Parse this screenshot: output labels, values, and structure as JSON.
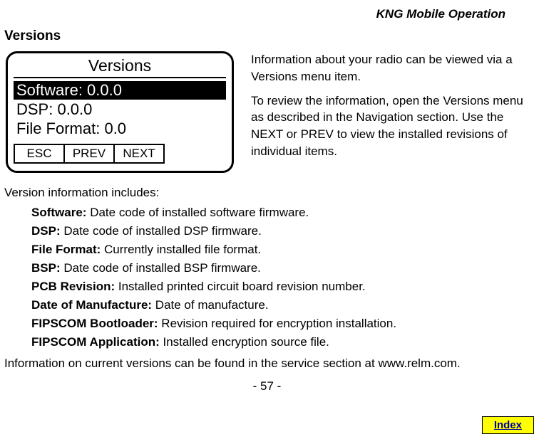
{
  "header": {
    "title": "KNG Mobile Operation"
  },
  "section": {
    "title": "Versions"
  },
  "screen": {
    "title": "Versions",
    "items": [
      {
        "text": "Software: 0.0.0",
        "highlighted": true
      },
      {
        "text": "DSP:  0.0.0",
        "highlighted": false
      },
      {
        "text": "File Format: 0.0",
        "highlighted": false
      }
    ],
    "softkeys": [
      "ESC",
      "PREV",
      "NEXT"
    ]
  },
  "description": {
    "p1": "Information about your radio can be viewed via a Versions menu item.",
    "p2": "To review the information, open the Versions menu as described in the Navigation section. Use the NEXT or PREV to view the installed revisions of individual items."
  },
  "info": {
    "intro": "Version information includes:",
    "items": [
      {
        "label": "Software:",
        "desc": " Date code of installed software firmware."
      },
      {
        "label": "DSP:",
        "desc": " Date code of installed DSP firmware."
      },
      {
        "label": "File Format:",
        "desc": " Currently installed file format."
      },
      {
        "label": "BSP:",
        "desc": " Date code of installed BSP firmware."
      },
      {
        "label": "PCB Revision:",
        "desc": " Installed printed circuit board revision number."
      },
      {
        "label": "Date of Manufacture:",
        "desc": " Date of manufacture."
      },
      {
        "label": "FIPSCOM Bootloader:",
        "desc": " Revision required for encryption installation."
      },
      {
        "label": "FIPSCOM Application:",
        "desc": " Installed encryption source file."
      }
    ],
    "footer": "Information on current versions can be found in the service section at www.relm.com."
  },
  "page": {
    "number": "- 57 -"
  },
  "index": {
    "label": "Index"
  }
}
